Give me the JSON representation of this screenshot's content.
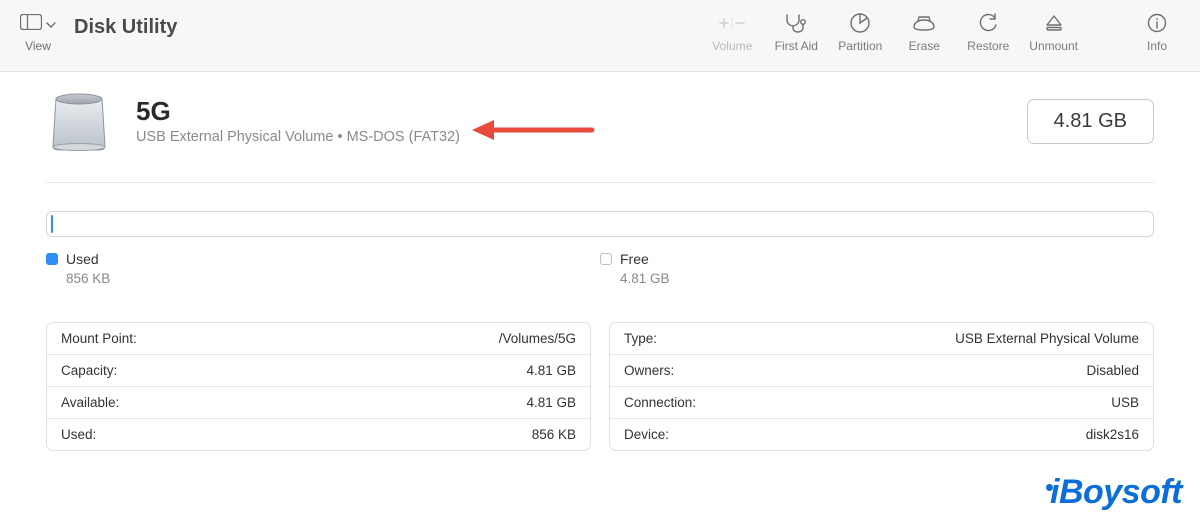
{
  "toolbar": {
    "app_title": "Disk Utility",
    "view_label": "View",
    "buttons": {
      "volume_label": "Volume",
      "first_aid_label": "First Aid",
      "partition_label": "Partition",
      "erase_label": "Erase",
      "restore_label": "Restore",
      "unmount_label": "Unmount",
      "info_label": "Info"
    }
  },
  "volume": {
    "name": "5G",
    "subtitle": "USB External Physical Volume • MS-DOS (FAT32)",
    "total_size": "4.81 GB"
  },
  "usage": {
    "used_label": "Used",
    "used_value": "856 KB",
    "free_label": "Free",
    "free_value": "4.81 GB"
  },
  "details_left": [
    {
      "k": "Mount Point:",
      "v": "/Volumes/5G"
    },
    {
      "k": "Capacity:",
      "v": "4.81 GB"
    },
    {
      "k": "Available:",
      "v": "4.81 GB"
    },
    {
      "k": "Used:",
      "v": "856 KB"
    }
  ],
  "details_right": [
    {
      "k": "Type:",
      "v": "USB External Physical Volume"
    },
    {
      "k": "Owners:",
      "v": "Disabled"
    },
    {
      "k": "Connection:",
      "v": "USB"
    },
    {
      "k": "Device:",
      "v": "disk2s16"
    }
  ],
  "watermark": "iBoysoft"
}
